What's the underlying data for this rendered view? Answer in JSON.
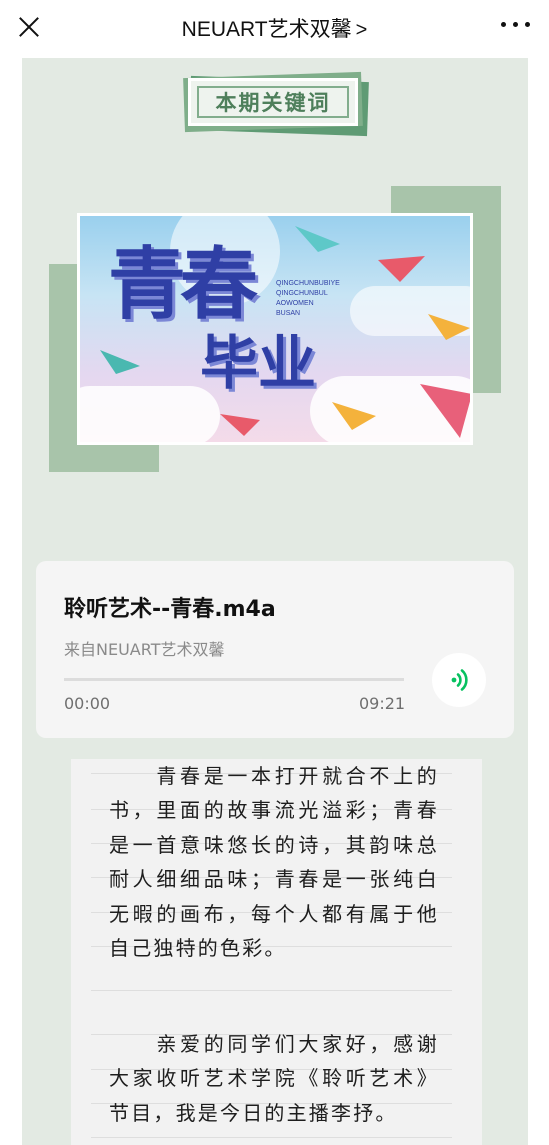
{
  "header": {
    "title": "NEUART艺术双馨",
    "title_chevron": ">"
  },
  "icons": {
    "close": "close-icon",
    "more": "more-icon",
    "audio": "audio-wave-icon"
  },
  "keyword_tag": {
    "text": "本期关键词"
  },
  "banner": {
    "main_text": "青春",
    "sub_text": "毕业",
    "pinyin_lines": [
      "QINGCHUNBUBIYE",
      "QINGCHUNBUL",
      "AOWOMEN",
      "BUSAN"
    ]
  },
  "audio": {
    "title": "聆听艺术--青春.m4a",
    "source": "来自NEUART艺术双馨",
    "current_time": "00:00",
    "total_time": "09:21",
    "progress": 0
  },
  "article": {
    "paragraph_1": "　　青春是一本打开就合不上的书，里面的故事流光溢彩；青春是一首意味悠长的诗，其韵味总耐人细细品味；青春是一张纯白无暇的画布，每个人都有属于他自己独特的色彩。",
    "paragraph_2": "　　亲爱的同学们大家好，感谢大家收听艺术学院《聆听艺术》节目，我是今日的主播李抒。"
  },
  "colors": {
    "panel_bg": "#e3eae3",
    "accent_green": "#07c160",
    "tag_green": "#4e7f5b",
    "banner_text": "#2f3fa5"
  }
}
